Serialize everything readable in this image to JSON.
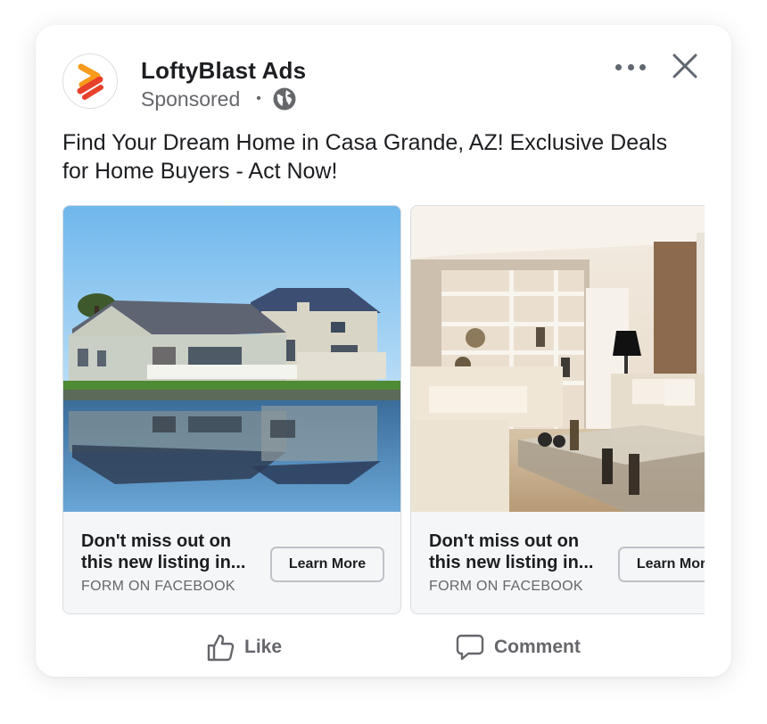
{
  "ad": {
    "advertiser": "LoftyBlast Ads",
    "sponsored_label": "Sponsored",
    "separator": "•",
    "caption": "Find Your Dream Home in Casa Grande, AZ! Exclusive Deals for Home Buyers - Act Now!",
    "brand_color": "#f26b21"
  },
  "carousel": [
    {
      "image": "lakeside-house-photo",
      "headline": "Don't miss out on this new listing in...",
      "subtitle": "FORM ON FACEBOOK",
      "cta": "Learn More"
    },
    {
      "image": "living-room-interior-photo",
      "headline": "Don't miss out on this new listing in...",
      "subtitle": "FORM ON FACEBOOK",
      "cta": "Learn More"
    }
  ],
  "actions": {
    "like": "Like",
    "comment": "Comment"
  },
  "icons": {
    "more": "more-options-icon",
    "close": "close-icon",
    "audience": "globe-icon",
    "like": "thumbs-up-icon",
    "comment": "comment-bubble-icon"
  }
}
